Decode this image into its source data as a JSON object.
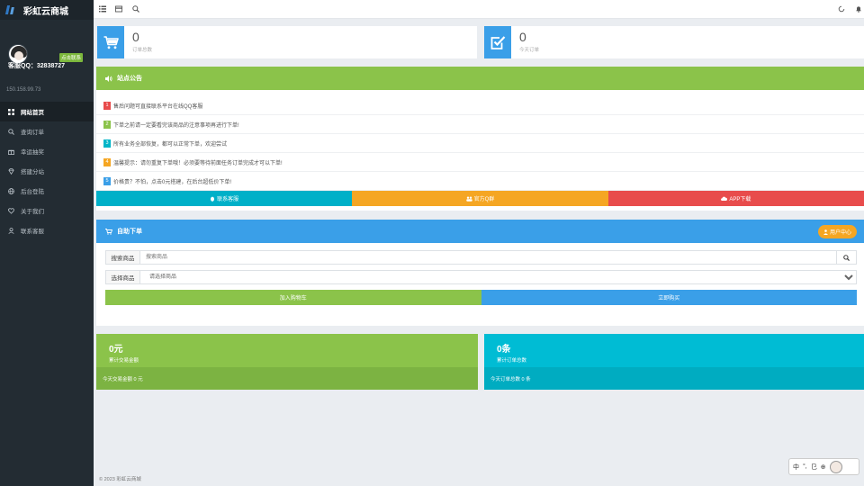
{
  "brand": {
    "title": "彩虹云商城"
  },
  "profile": {
    "contact_badge": "点击联系",
    "qq_label": "客服QQ：32838727",
    "ip": "150.158.99.73"
  },
  "nav": [
    {
      "label": "网站首页",
      "icon": "grid-icon",
      "active": true
    },
    {
      "label": "查询订单",
      "icon": "search-icon"
    },
    {
      "label": "幸运抽奖",
      "icon": "gift-icon"
    },
    {
      "label": "搭建分站",
      "icon": "diamond-icon"
    },
    {
      "label": "后台登陆",
      "icon": "globe-icon"
    },
    {
      "label": "关于我们",
      "icon": "heart-icon"
    },
    {
      "label": "联系客服",
      "icon": "user-icon"
    }
  ],
  "stats": [
    {
      "value": "0",
      "label": "订单总数",
      "icon": "cart-icon"
    },
    {
      "value": "0",
      "label": "今天订单",
      "icon": "checkbox-icon"
    }
  ],
  "notice": {
    "title": "站点公告",
    "items": [
      {
        "num": "1",
        "text": "售后问题可直接联系平台在线QQ客服",
        "color": "#e84c4c"
      },
      {
        "num": "2",
        "text": "下单之前请一定要看完该商品的注意事项再进行下单!",
        "color": "#8bc34a"
      },
      {
        "num": "3",
        "text": "所有业务全部恢复，都可以正常下单，欢迎尝试",
        "color": "#00b5c8"
      },
      {
        "num": "4",
        "text": "温馨提示：请勿重复下单哦！必须要等待前面任务订单完成才可以下单!",
        "color": "#f5a623"
      },
      {
        "num": "5",
        "text": "价格贵？不怕，点击0元搭建，在后台超低价下单!",
        "color": "#3a9fe8"
      }
    ],
    "buttons": [
      {
        "label": "联系客服",
        "color": "#00b0c8"
      },
      {
        "label": "官方Q群",
        "color": "#f5a623"
      },
      {
        "label": "APP下载",
        "color": "#e84c4c"
      }
    ]
  },
  "order": {
    "title": "自助下单",
    "user_center": "用户中心",
    "search_label": "搜索商品",
    "search_placeholder": "搜索商品",
    "select_label": "选择商品",
    "select_value": "请选择商品",
    "add_cart": "加入购物车",
    "buy_now": "立即购买"
  },
  "summary": [
    {
      "value": "0元",
      "label": "累计交易金额",
      "footer": "今天交易金额 0 元",
      "color": "#8bc34a",
      "footer_color": "#7cb342"
    },
    {
      "value": "0条",
      "label": "累计订单总数",
      "footer": "今天订单总数 0 条",
      "color": "#00bcd4",
      "footer_color": "#00acc1"
    }
  ],
  "footer": "© 2023 彩虹云商城",
  "ime": {
    "lang": "中",
    "items": [
      "°,",
      "㔾",
      "⊕"
    ]
  }
}
